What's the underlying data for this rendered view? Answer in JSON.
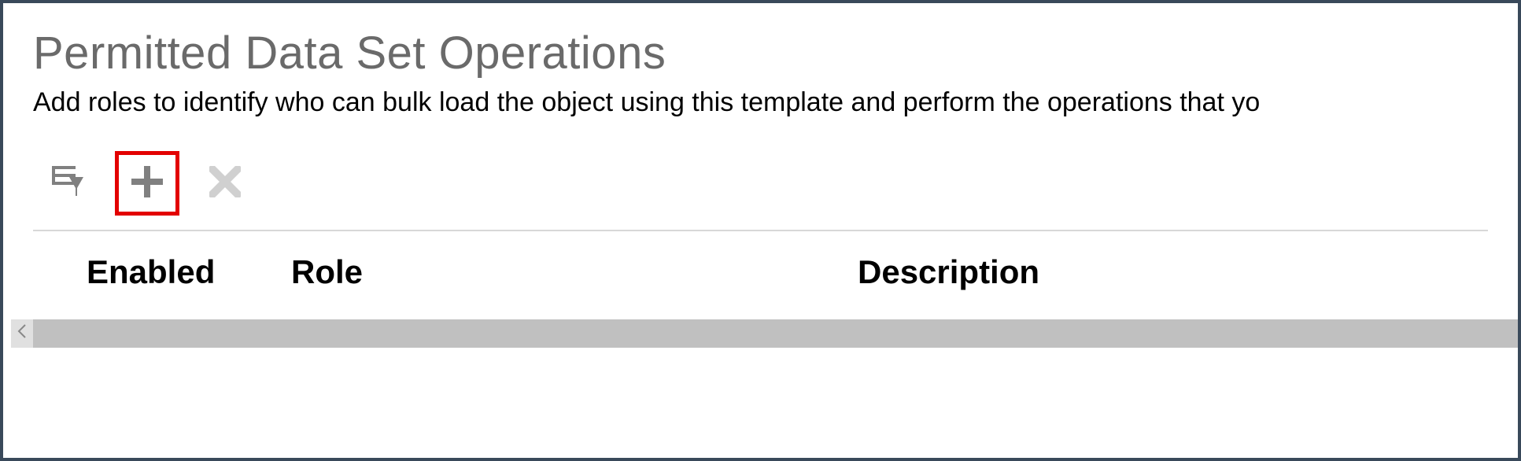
{
  "panel": {
    "title": "Permitted Data Set Operations",
    "subtitle": "Add roles to identify who can bulk load the object using this template and perform the operations that yo"
  },
  "toolbar": {
    "query_icon": "query-by-example",
    "add_icon": "add",
    "remove_icon": "remove"
  },
  "table": {
    "headers": {
      "enabled": "Enabled",
      "role": "Role",
      "description": "Description"
    }
  }
}
